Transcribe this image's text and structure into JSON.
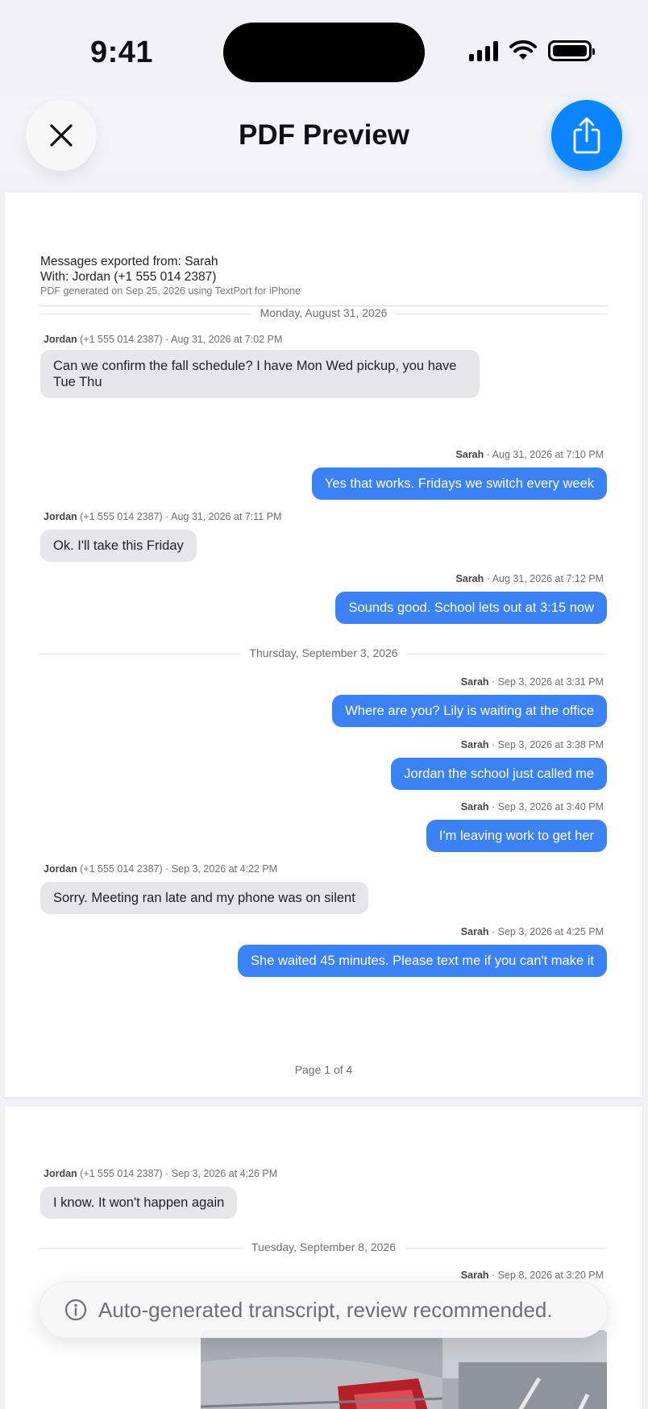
{
  "status_bar": {
    "time": "9:41"
  },
  "header": {
    "title": "PDF Preview"
  },
  "meta": {
    "exported_from": "Messages exported from: Sarah",
    "with": "With: Jordan (+1 555 014 2387)",
    "generated": "PDF generated on Sep 25, 2026 using TextPort for iPhone"
  },
  "pages": [
    {
      "date_separators": [
        "Monday, August 31, 2026",
        "Thursday, September 3, 2026"
      ],
      "messages": [
        {
          "sender": "Jordan",
          "number": "(+1 555 014 2387)",
          "time": "Aug 31, 2026 at 7:02 PM",
          "text": "Can we confirm the fall schedule? I have Mon Wed pickup, you have Tue Thu"
        },
        {
          "sender": "Sarah",
          "time": "Aug 31, 2026 at 7:10 PM",
          "text": "Yes that works. Fridays we switch every week"
        },
        {
          "sender": "Jordan",
          "number": "(+1 555 014 2387)",
          "time": "Aug 31, 2026 at 7:11 PM",
          "text": "Ok. I'll take this Friday"
        },
        {
          "sender": "Sarah",
          "time": "Aug 31, 2026 at 7:12 PM",
          "text": "Sounds good. School lets out at 3:15 now"
        },
        {
          "sender": "Sarah",
          "time": "Sep 3, 2026 at 3:31 PM",
          "text": "Where are you? Lily is waiting at the office"
        },
        {
          "sender": "Sarah",
          "time": "Sep 3, 2026 at 3:38 PM",
          "text": "Jordan the school just called me"
        },
        {
          "sender": "Sarah",
          "time": "Sep 3, 2026 at 3:40 PM",
          "text": "I'm leaving work to get her"
        },
        {
          "sender": "Jordan",
          "number": "(+1 555 014 2387)",
          "time": "Sep 3, 2026 at 4:22 PM",
          "text": "Sorry. Meeting ran late and my phone was on silent"
        },
        {
          "sender": "Sarah",
          "time": "Sep 3, 2026 at 4:25 PM",
          "text": "She waited 45 minutes. Please text me if you can't make it"
        }
      ],
      "page_label": "Page 1 of 4"
    },
    {
      "date_separators": [
        "Tuesday, September 8, 2026"
      ],
      "messages": [
        {
          "sender": "Jordan",
          "number": "(+1 555 014 2387)",
          "time": "Sep 3, 2026 at 4:26 PM",
          "text": "I know. It won't happen again"
        },
        {
          "sender": "Sarah",
          "time": "Sep 8, 2026 at 3:20 PM"
        }
      ]
    }
  ],
  "toast": {
    "text": "Auto-generated transcript, review recommended."
  },
  "colors": {
    "accent": "#0a84ff",
    "outgoing_bubble": "#3b82f6",
    "incoming_bubble": "#e6e6ea"
  }
}
